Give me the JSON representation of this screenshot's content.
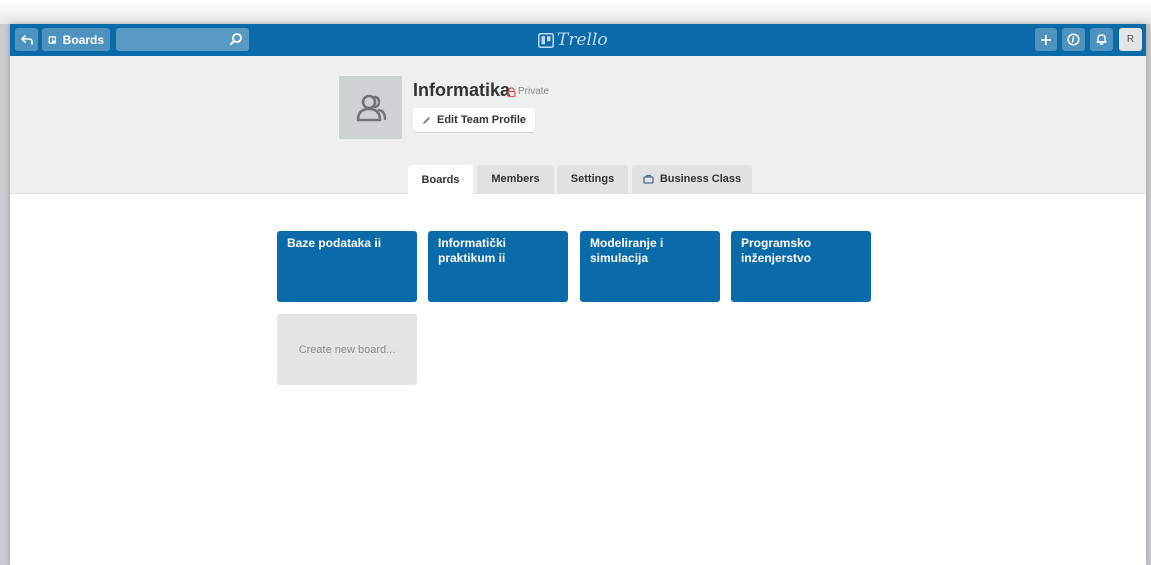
{
  "header": {
    "boards_label": "Boards",
    "search": {
      "value": "",
      "placeholder": ""
    },
    "logo_text": "Trello",
    "avatar_initial": "R",
    "icons": [
      "back-icon",
      "boards-icon",
      "search-icon",
      "add-icon",
      "info-icon",
      "bell-icon"
    ],
    "colors": {
      "header": "#0b6aa8",
      "board_tile": "#0b6aa8",
      "private": "#d9534f"
    }
  },
  "team": {
    "name": "Informatika",
    "visibility": "Private",
    "edit_label": "Edit Team Profile"
  },
  "tabs": [
    {
      "label": "Boards",
      "active": true
    },
    {
      "label": "Members",
      "active": false
    },
    {
      "label": "Settings",
      "active": false
    },
    {
      "label": "Business Class",
      "active": false
    }
  ],
  "boards": [
    {
      "title": "Baze podataka ii"
    },
    {
      "title": "Informatički praktikum ii"
    },
    {
      "title": "Modeliranje i simulacija"
    },
    {
      "title": "Programsko inženjerstvo"
    }
  ],
  "create_label": "Create new board..."
}
